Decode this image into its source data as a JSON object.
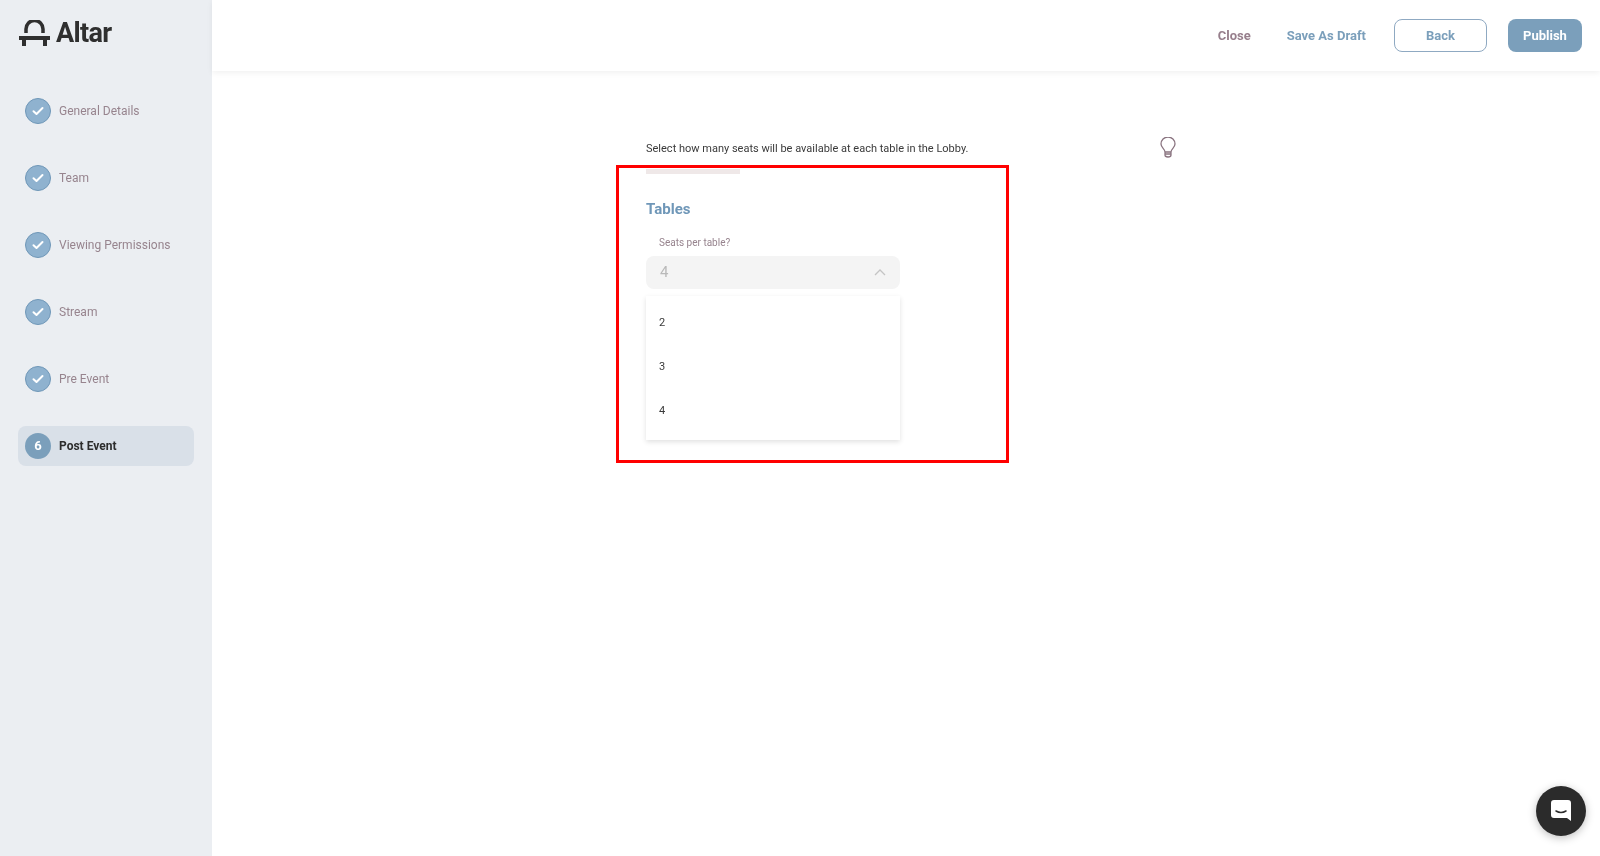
{
  "logo": {
    "text": "Altar"
  },
  "steps": [
    {
      "label": "General Details",
      "completed": true,
      "selected": false
    },
    {
      "label": "Team",
      "completed": true,
      "selected": false
    },
    {
      "label": "Viewing Permissions",
      "completed": true,
      "selected": false
    },
    {
      "label": "Stream",
      "completed": true,
      "selected": false
    },
    {
      "label": "Pre Event",
      "completed": true,
      "selected": false
    },
    {
      "label": "Post Event",
      "number": "6",
      "completed": false,
      "selected": true
    }
  ],
  "header": {
    "close": "Close",
    "save_draft": "Save As Draft",
    "back": "Back",
    "publish": "Publish"
  },
  "description": "Select how many seats will be available at each table in the Lobby.",
  "section": {
    "title": "Tables",
    "field_label": "Seats per table?",
    "value": "4",
    "expanded": true,
    "options": [
      {
        "label": "2"
      },
      {
        "label": "3"
      },
      {
        "label": "4"
      }
    ]
  }
}
